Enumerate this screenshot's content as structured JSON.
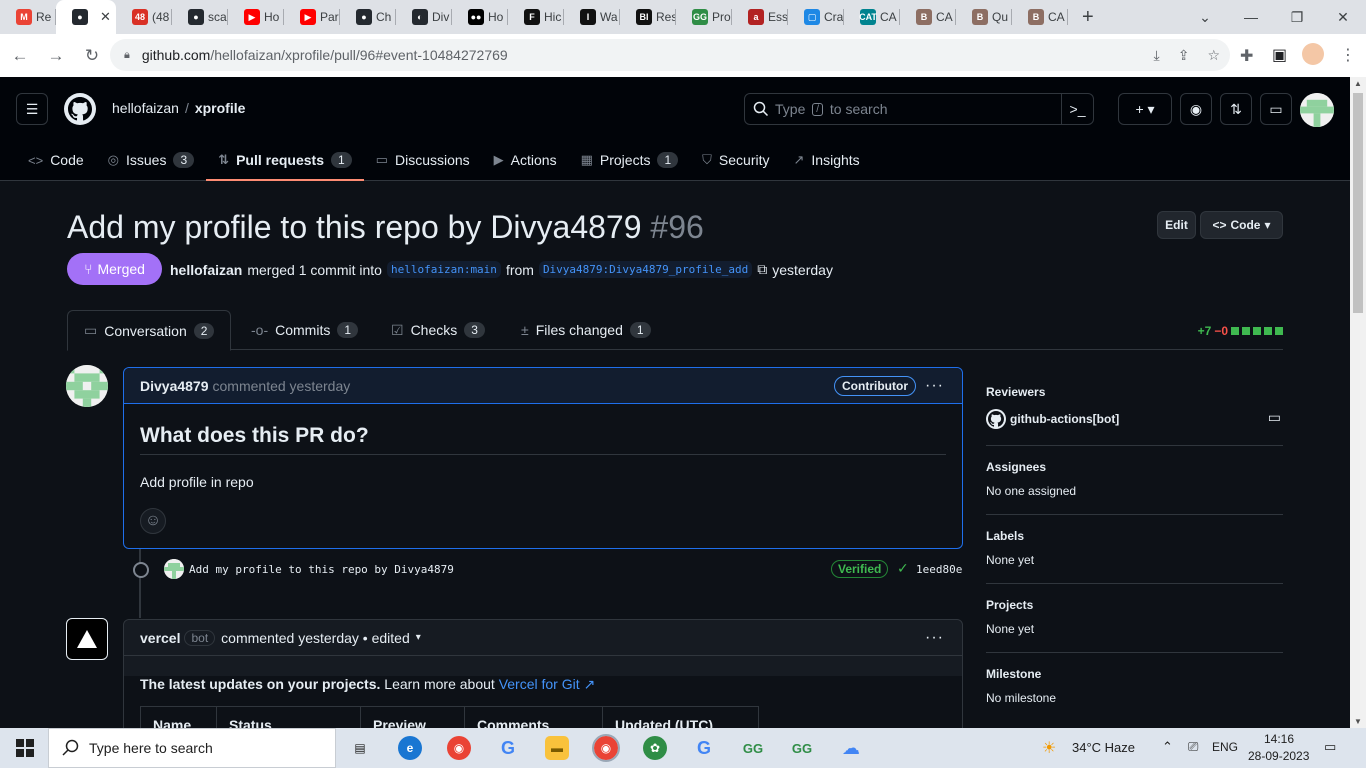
{
  "browser": {
    "tabs": [
      {
        "label": "Re",
        "favicon": "gmail-icon",
        "color": "#ea4335",
        "glyph": "M"
      },
      {
        "label": "",
        "favicon": "github-icon",
        "color": "#24292f",
        "glyph": "●",
        "active": true
      },
      {
        "label": "(48",
        "favicon": "badge-icon",
        "color": "#d93025",
        "glyph": "48"
      },
      {
        "label": "sca",
        "favicon": "github-icon",
        "color": "#24292f",
        "glyph": "●"
      },
      {
        "label": "Ho",
        "favicon": "youtube-icon",
        "color": "#ff0000",
        "glyph": "▶"
      },
      {
        "label": "Par",
        "favicon": "youtube-icon",
        "color": "#ff0000",
        "glyph": "▶"
      },
      {
        "label": "Ch",
        "favicon": "github-icon",
        "color": "#24292f",
        "glyph": "●"
      },
      {
        "label": "Div",
        "favicon": "github-alt-icon",
        "color": "#24292f",
        "glyph": "◐"
      },
      {
        "label": "Ho",
        "favicon": "medium-icon",
        "color": "#000000",
        "glyph": "●●"
      },
      {
        "label": "Hic",
        "favicon": "forbes-icon",
        "color": "#111111",
        "glyph": "F"
      },
      {
        "label": "Wa",
        "favicon": "text-icon",
        "color": "#111111",
        "glyph": "I"
      },
      {
        "label": "Res",
        "favicon": "bi-icon",
        "color": "#111111",
        "glyph": "BI"
      },
      {
        "label": "Pro",
        "favicon": "gfg-icon",
        "color": "#2f8d46",
        "glyph": "GG"
      },
      {
        "label": "Ess",
        "favicon": "a-icon",
        "color": "#b22222",
        "glyph": "a"
      },
      {
        "label": "Cra",
        "favicon": "browser-icon",
        "color": "#1e88e5",
        "glyph": "▢"
      },
      {
        "label": "CA",
        "favicon": "cat-icon",
        "color": "#00838f",
        "glyph": "CAT"
      },
      {
        "label": "CA",
        "favicon": "ring-icon",
        "color": "#8d6e63",
        "glyph": "B"
      },
      {
        "label": "Qu",
        "favicon": "ring-icon",
        "color": "#8d6e63",
        "glyph": "B"
      },
      {
        "label": "CA",
        "favicon": "ring-icon",
        "color": "#8d6e63",
        "glyph": "B"
      }
    ],
    "close_glyph": "✕",
    "new_tab": "+",
    "url_host": "github.com",
    "url_path": "/hellofaizan/xprofile/pull/96#event-10484272769"
  },
  "header": {
    "owner": "hellofaizan",
    "separator": "/",
    "repo": "xprofile",
    "search_prefix": "Type",
    "search_key": "/",
    "search_suffix": "to search",
    "plus": "+"
  },
  "repo_nav": [
    {
      "label": "Code",
      "icon": "code-icon",
      "glyph": "<>",
      "count": ""
    },
    {
      "label": "Issues",
      "icon": "issue-icon",
      "glyph": "◎",
      "count": "3"
    },
    {
      "label": "Pull requests",
      "icon": "pull-request-icon",
      "glyph": "⇅",
      "count": "1",
      "selected": true
    },
    {
      "label": "Discussions",
      "icon": "discussion-icon",
      "glyph": "▭",
      "count": ""
    },
    {
      "label": "Actions",
      "icon": "play-icon",
      "glyph": "▶",
      "count": ""
    },
    {
      "label": "Projects",
      "icon": "table-icon",
      "glyph": "▦",
      "count": "1"
    },
    {
      "label": "Security",
      "icon": "shield-icon",
      "glyph": "⛉",
      "count": ""
    },
    {
      "label": "Insights",
      "icon": "graph-icon",
      "glyph": "↗",
      "count": ""
    }
  ],
  "pr": {
    "title": "Add my profile to this repo by Divya4879",
    "number": "#96",
    "edit_label": "Edit",
    "code_label": "Code",
    "state": "Merged",
    "merger": "hellofaizan",
    "merge_text": "merged 1 commit into",
    "base_branch": "hellofaizan:main",
    "from_text": "from",
    "head_branch": "Divya4879:Divya4879_profile_add",
    "when": "yesterday"
  },
  "pr_tabs": [
    {
      "label": "Conversation",
      "icon": "conversation-icon",
      "glyph": "▭",
      "count": "2"
    },
    {
      "label": "Commits",
      "icon": "commit-icon",
      "glyph": "-o-",
      "count": "1"
    },
    {
      "label": "Checks",
      "icon": "checklist-icon",
      "glyph": "☑",
      "count": "3"
    },
    {
      "label": "Files changed",
      "icon": "file-diff-icon",
      "glyph": "±",
      "count": "1"
    }
  ],
  "diffstat": {
    "additions": "+7",
    "deletions": "−0"
  },
  "comment1": {
    "author": "Divya4879",
    "action": "commented yesterday",
    "badge": "Contributor",
    "heading": "What does this PR do?",
    "body": "Add profile in repo",
    "more": "···"
  },
  "commit": {
    "message": "Add my profile to this repo by Divya4879",
    "verified": "Verified",
    "sha": "1eed80e"
  },
  "comment2": {
    "author": "vercel",
    "bot_label": "bot",
    "action": "commented yesterday • edited",
    "more": "···",
    "lead_bold": "The latest updates on your projects.",
    "lead_text": "Learn more about",
    "link": "Vercel for Git ↗",
    "table_headers": [
      "Name",
      "Status",
      "Preview",
      "Comments",
      "Updated (UTC)"
    ]
  },
  "sidebar": {
    "reviewers_title": "Reviewers",
    "reviewer": "github-actions[bot]",
    "assignees_title": "Assignees",
    "assignees_value": "No one assigned",
    "labels_title": "Labels",
    "labels_value": "None yet",
    "projects_title": "Projects",
    "projects_value": "None yet",
    "milestone_title": "Milestone",
    "milestone_value": "No milestone"
  },
  "taskbar": {
    "search_placeholder": "Type here to search",
    "weather": "34°C  Haze",
    "lang": "ENG",
    "time": "14:16",
    "date": "28-09-2023"
  }
}
